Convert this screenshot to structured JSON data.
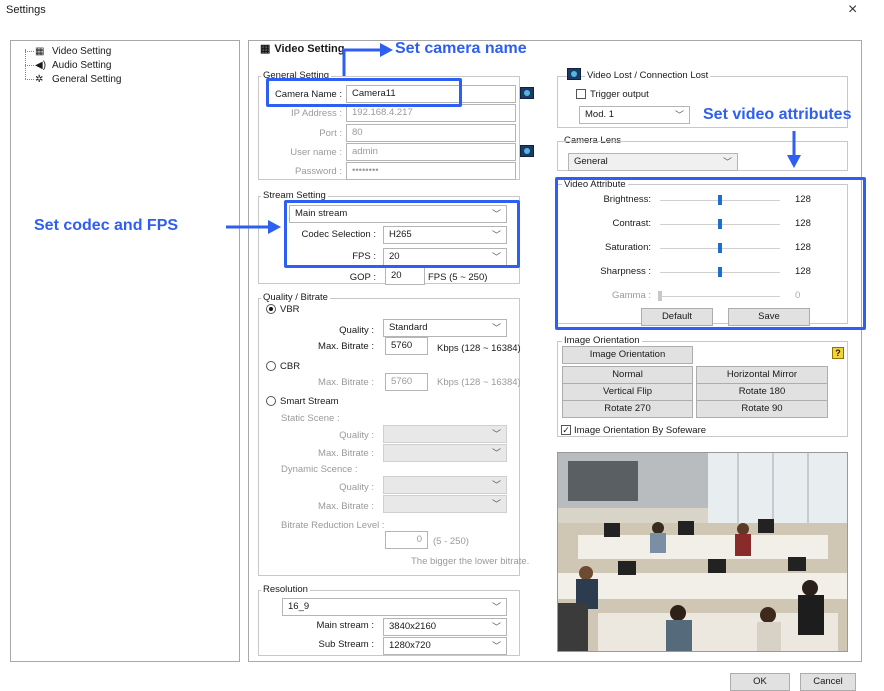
{
  "window": {
    "title": "Settings",
    "close_glyph": "×"
  },
  "tree": {
    "items": [
      {
        "label": "Video Setting",
        "icon": "film-icon",
        "glyph": "▦"
      },
      {
        "label": "Audio Setting",
        "icon": "speaker-icon",
        "glyph": "◀)"
      },
      {
        "label": "General Setting",
        "icon": "gear-icon",
        "glyph": "✲"
      }
    ]
  },
  "panel": {
    "title": "Video Setting",
    "title_icon": "film-icon",
    "title_glyph": "▦"
  },
  "annotations": {
    "camera_name": "Set camera name",
    "codec_fps": "Set codec and FPS",
    "video_attributes": "Set video attributes",
    "color": "#2f5ef2"
  },
  "general": {
    "label": "General Setting",
    "camera_name_label": "Camera Name :",
    "camera_name": "Camera11",
    "ip_label": "IP Address :",
    "ip": "192.168.4.217",
    "port_label": "Port :",
    "port": "80",
    "user_label": "User name :",
    "user": "admin",
    "password_label": "Password :",
    "password": "••••••••"
  },
  "stream": {
    "label": "Stream Setting",
    "stream_select": "Main stream",
    "codec_label": "Codec Selection :",
    "codec": "H265",
    "fps_label": "FPS :",
    "fps": "20",
    "gop_label": "GOP :",
    "gop": "20",
    "gop_hint": "FPS (5 ~ 250)"
  },
  "quality": {
    "label": "Quality / Bitrate",
    "vbr_label": "VBR",
    "quality_label": "Quality :",
    "quality": "Standard",
    "maxbitrate_label": "Max. Bitrate :",
    "maxbitrate": "5760",
    "maxbitrate_hint": "Kbps (128 ~ 16384)",
    "cbr_label": "CBR",
    "cbr_maxbitrate_label": "Max. Bitrate :",
    "cbr_maxbitrate": "5760",
    "cbr_maxbitrate_hint": "Kbps (128 ~ 16384)",
    "smart_label": "Smart Stream",
    "static_label": "Static Scene :",
    "static_quality_label": "Quality :",
    "static_maxbitrate_label": "Max. Bitrate :",
    "dynamic_label": "Dynamic Scence :",
    "dynamic_quality_label": "Quality :",
    "dynamic_maxbitrate_label": "Max. Bitrate :",
    "reduction_label": "Bitrate Reduction Level :",
    "reduction": "0",
    "reduction_hint": "(5 - 250)",
    "reduction_note": "The bigger the lower bitrate."
  },
  "resolution": {
    "label": "Resolution",
    "aspect": "16_9",
    "main_label": "Main stream :",
    "main": "3840x2160",
    "sub_label": "Sub Stream :",
    "sub": "1280x720"
  },
  "videolost": {
    "label": "Video Lost / Connection Lost",
    "trigger_label": "Trigger output",
    "module": "Mod. 1"
  },
  "lens": {
    "label": "Camera Lens",
    "value": "General"
  },
  "attribute": {
    "label": "Video Attribute",
    "sliders": [
      {
        "label": "Brightness:",
        "value": "128",
        "level": 0.5,
        "enabled": true
      },
      {
        "label": "Contrast:",
        "value": "128",
        "level": 0.5,
        "enabled": true
      },
      {
        "label": "Saturation:",
        "value": "128",
        "level": 0.5,
        "enabled": true
      },
      {
        "label": "Sharpness :",
        "value": "128",
        "level": 0.5,
        "enabled": true
      },
      {
        "label": "Gamma :",
        "value": "0",
        "level": 0,
        "enabled": false
      }
    ],
    "default_label": "Default",
    "save_label": "Save"
  },
  "orientation": {
    "label": "Image Orientation",
    "main_button": "Image Orientation",
    "help_glyph": "?",
    "options": [
      "Normal",
      "Horizontal Mirror",
      "Vertical Flip",
      "Rotate 180",
      "Rotate 270",
      "Rotate 90"
    ],
    "software_label": "Image Orientation By Sofeware",
    "software_checked": true
  },
  "footer": {
    "ok_label": "OK",
    "cancel_label": "Cancel"
  },
  "chevron_glyph": "﹀"
}
